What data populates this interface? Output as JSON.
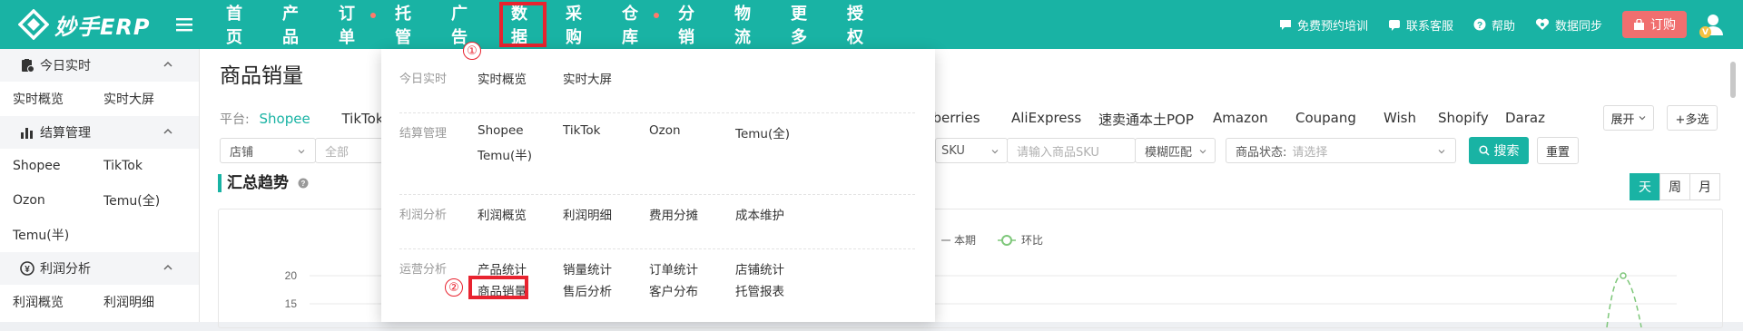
{
  "app": {
    "brand": "妙手ERP"
  },
  "nav": {
    "items": [
      {
        "label": "首页"
      },
      {
        "label": "产品"
      },
      {
        "label": "订单",
        "dot": true
      },
      {
        "label": "托管"
      },
      {
        "label": "广告"
      },
      {
        "label": "数据",
        "highlight": true
      },
      {
        "label": "采购"
      },
      {
        "label": "仓库",
        "dot": true
      },
      {
        "label": "分销"
      },
      {
        "label": "物流"
      },
      {
        "label": "更多"
      },
      {
        "label": "授权"
      }
    ]
  },
  "header_tools": {
    "training": "免费预约培训",
    "support": "联系客服",
    "help": "帮助",
    "sync": "数据同步",
    "buy": "订购",
    "avatar_badge": "V"
  },
  "sidebar": {
    "groups": [
      {
        "title": "今日实时",
        "icon": "clipboard-icon",
        "items": [
          "实时概览",
          "实时大屏"
        ]
      },
      {
        "title": "结算管理",
        "icon": "bar-chart-icon",
        "items": [
          "Shopee",
          "TikTok",
          "Ozon",
          "Temu(全)",
          "Temu(半)"
        ]
      },
      {
        "title": "利润分析",
        "icon": "money-cycle-icon",
        "items": [
          "利润概览",
          "利润明细"
        ]
      }
    ]
  },
  "main": {
    "title": "商品销量",
    "platform_label": "平台:",
    "platforms_left": [
      "Shopee",
      "TikTok"
    ],
    "platforms_right": [
      "dberries",
      "AliExpress",
      "速卖通本土POP",
      "Amazon",
      "Coupang",
      "Wish",
      "Shopify",
      "Daraz"
    ],
    "expand_btn": "展开",
    "multi_btn": "+多选",
    "store_select": "店铺",
    "store_value": "全部",
    "sku_select": "SKU",
    "sku_placeholder": "请输入商品SKU",
    "match_select": "模糊匹配",
    "status_label": "商品状态:",
    "status_placeholder": "请选择",
    "search_btn": "搜索",
    "reset_btn": "重置",
    "section_title": "汇总趋势",
    "range_tabs": [
      "天",
      "周",
      "月"
    ],
    "active_range": "天"
  },
  "chart_data": {
    "type": "line",
    "legend": [
      "本期",
      "环比"
    ],
    "y_ticks": [
      20,
      15
    ],
    "series": [
      {
        "name": "本期",
        "values": []
      },
      {
        "name": "环比",
        "values": [
          20
        ]
      }
    ]
  },
  "dropdown": {
    "sections": [
      {
        "label": "今日实时",
        "items": [
          "实时概览",
          "实时大屏"
        ]
      },
      {
        "label": "结算管理",
        "items": [
          "Shopee",
          "TikTok",
          "Ozon",
          "Temu(全)",
          "Temu(半)"
        ]
      },
      {
        "label": "利润分析",
        "items": [
          "利润概览",
          "利润明细",
          "费用分摊",
          "成本维护"
        ]
      },
      {
        "label": "运营分析",
        "items": [
          "产品统计",
          "销量统计",
          "订单统计",
          "店铺统计",
          "商品销量",
          "售后分析",
          "客户分布",
          "托管报表"
        ]
      }
    ],
    "annotations": {
      "step1": "①",
      "step2": "②"
    }
  },
  "colors": {
    "primary": "#19b3a4",
    "highlight": "#e8232f",
    "buy": "#f06f6f"
  }
}
